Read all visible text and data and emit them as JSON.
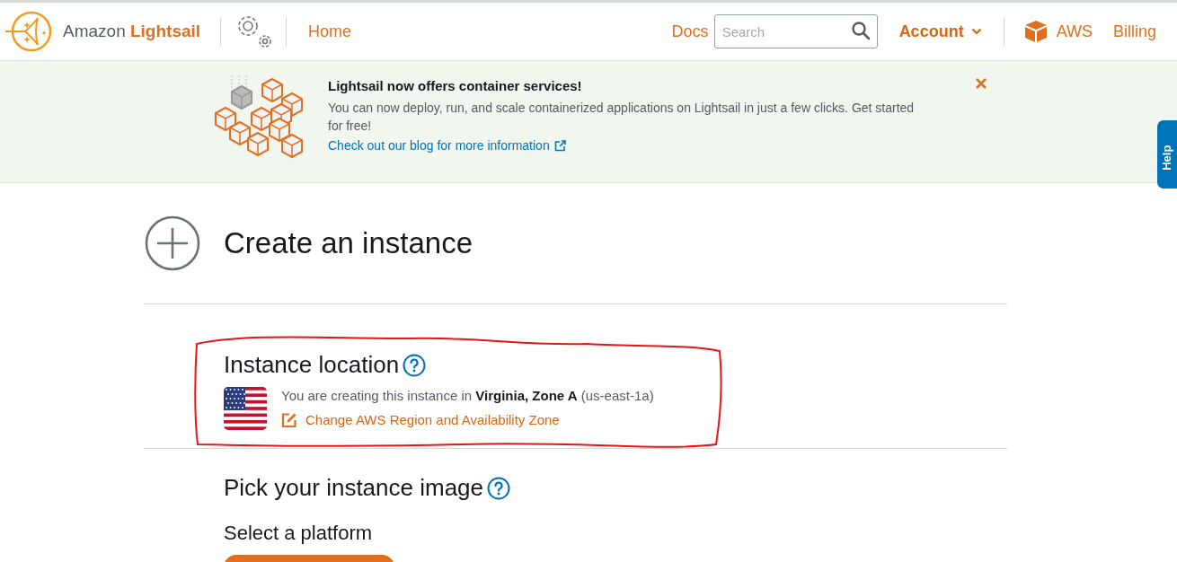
{
  "header": {
    "brand": {
      "prefix": "Amazon",
      "name": "Lightsail"
    },
    "nav": [
      {
        "label": "Home"
      }
    ],
    "docs": "Docs",
    "search": {
      "placeholder": "Search"
    },
    "account": "Account",
    "links": [
      {
        "label": "AWS",
        "kind": "aws"
      },
      {
        "label": "Billing",
        "kind": "plain"
      }
    ]
  },
  "banner": {
    "title": "Lightsail now offers container services!",
    "body": "You can now deploy, run, and scale containerized applications on Lightsail in just a few clicks. Get started for free!",
    "link": "Check out our blog for more information"
  },
  "help_tab": {
    "label": "Help"
  },
  "page": {
    "title": "Create an instance"
  },
  "location": {
    "heading": "Instance location",
    "text": "You are creating this instance in **Virginia, Zone A** (us-east-1a)",
    "change_link": "Change AWS Region and Availability Zone"
  },
  "image_section": {
    "heading": "Pick your instance image",
    "subheading": "Select a platform"
  }
}
